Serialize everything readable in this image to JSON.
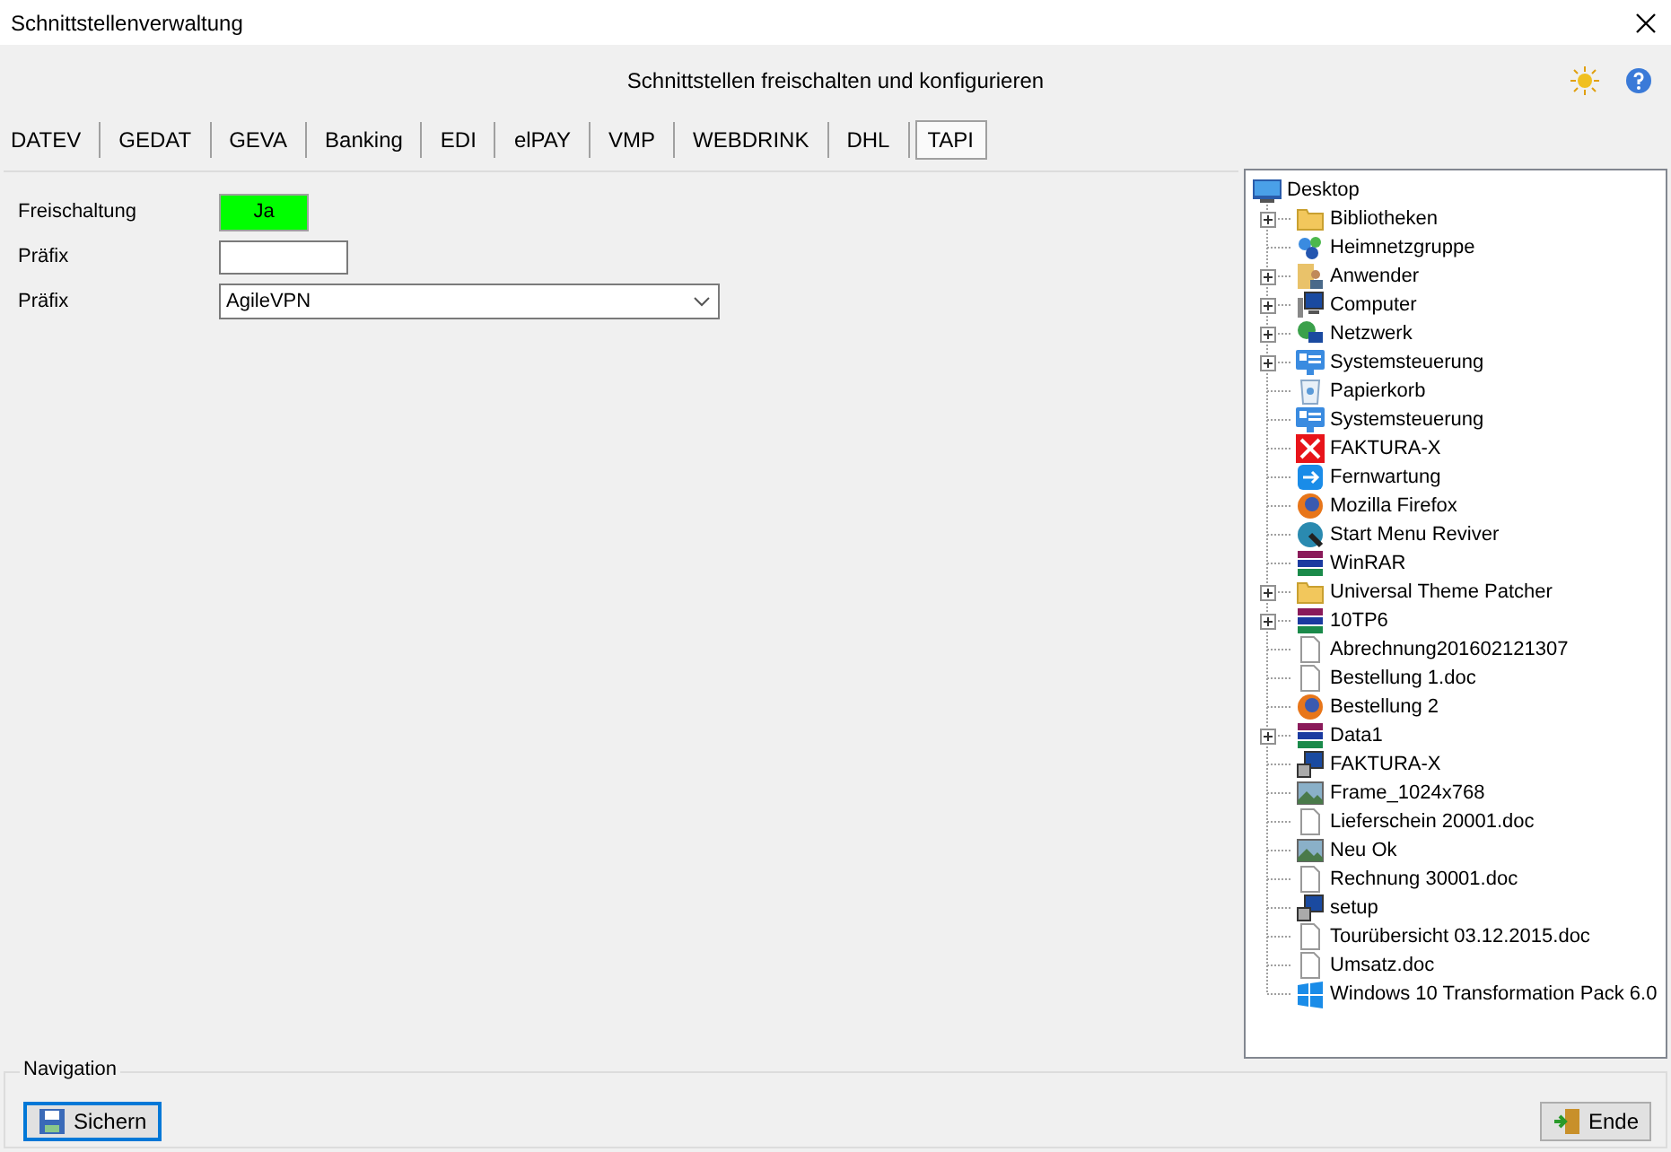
{
  "window": {
    "title": "Schnittstellenverwaltung"
  },
  "header": {
    "title": "Schnittstellen freischalten und konfigurieren"
  },
  "tabs": [
    {
      "label": "DATEV",
      "selected": false
    },
    {
      "label": "GEDAT",
      "selected": false
    },
    {
      "label": "GEVA",
      "selected": false
    },
    {
      "label": "Banking",
      "selected": false
    },
    {
      "label": "EDI",
      "selected": false
    },
    {
      "label": "elPAY",
      "selected": false
    },
    {
      "label": "VMP",
      "selected": false
    },
    {
      "label": "WEBDRINK",
      "selected": false
    },
    {
      "label": "DHL",
      "selected": false
    },
    {
      "label": "TAPI",
      "selected": true
    }
  ],
  "form": {
    "fields": [
      {
        "kind": "toggle",
        "label": "Freischaltung",
        "value": "Ja",
        "on": true
      },
      {
        "kind": "text",
        "label": "Präfix"
      },
      {
        "kind": "select",
        "label": "Präfix",
        "value": "AgileVPN"
      }
    ]
  },
  "tree": {
    "label": "Desktop",
    "kind": "desktop",
    "children": [
      {
        "label": "Bibliotheken",
        "kind": "folder",
        "collapsed": true
      },
      {
        "label": "Heimnetzgruppe",
        "kind": "network",
        "collapsed": false
      },
      {
        "label": "Anwender",
        "kind": "user",
        "collapsed": true
      },
      {
        "label": "Computer",
        "kind": "computer",
        "collapsed": true
      },
      {
        "label": "Netzwerk",
        "kind": "globe",
        "collapsed": true
      },
      {
        "label": "Systemsteuerung",
        "kind": "panel",
        "collapsed": true
      },
      {
        "label": "Papierkorb",
        "kind": "trash",
        "collapsed": false
      },
      {
        "label": "Systemsteuerung",
        "kind": "panel",
        "collapsed": false
      },
      {
        "label": "FAKTURA-X",
        "kind": "xapp",
        "collapsed": false
      },
      {
        "label": "Fernwartung",
        "kind": "remote",
        "collapsed": false
      },
      {
        "label": "Mozilla Firefox",
        "kind": "browser",
        "collapsed": false
      },
      {
        "label": "Start Menu Reviver",
        "kind": "app",
        "collapsed": false
      },
      {
        "label": "WinRAR",
        "kind": "archive",
        "collapsed": false
      },
      {
        "label": "Universal Theme Patcher",
        "kind": "folder",
        "collapsed": true
      },
      {
        "label": "10TP6",
        "kind": "archive",
        "collapsed": true
      },
      {
        "label": "Abrechnung201602121307",
        "kind": "document",
        "collapsed": false
      },
      {
        "label": "Bestellung 1.doc",
        "kind": "document",
        "collapsed": false
      },
      {
        "label": "Bestellung 2",
        "kind": "browser",
        "collapsed": false
      },
      {
        "label": "Data1",
        "kind": "archive",
        "collapsed": true
      },
      {
        "label": "FAKTURA-X",
        "kind": "setup",
        "collapsed": false
      },
      {
        "label": "Frame_1024x768",
        "kind": "image",
        "collapsed": false
      },
      {
        "label": "Lieferschein 20001.doc",
        "kind": "document",
        "collapsed": false
      },
      {
        "label": "Neu Ok",
        "kind": "image",
        "collapsed": false
      },
      {
        "label": "Rechnung 30001.doc",
        "kind": "document",
        "collapsed": false
      },
      {
        "label": "setup",
        "kind": "setup",
        "collapsed": false
      },
      {
        "label": "Tourübersicht 03.12.2015.doc",
        "kind": "document",
        "collapsed": false
      },
      {
        "label": "Umsatz.doc",
        "kind": "document",
        "collapsed": false
      },
      {
        "label": "Windows 10 Transformation Pack 6.0",
        "kind": "windows",
        "collapsed": false
      }
    ]
  },
  "navigation": {
    "title": "Navigation",
    "buttons": [
      {
        "label": "Sichern",
        "kind": "save",
        "focused": true
      },
      {
        "label": "Ende",
        "kind": "exit",
        "focused": false
      }
    ]
  }
}
